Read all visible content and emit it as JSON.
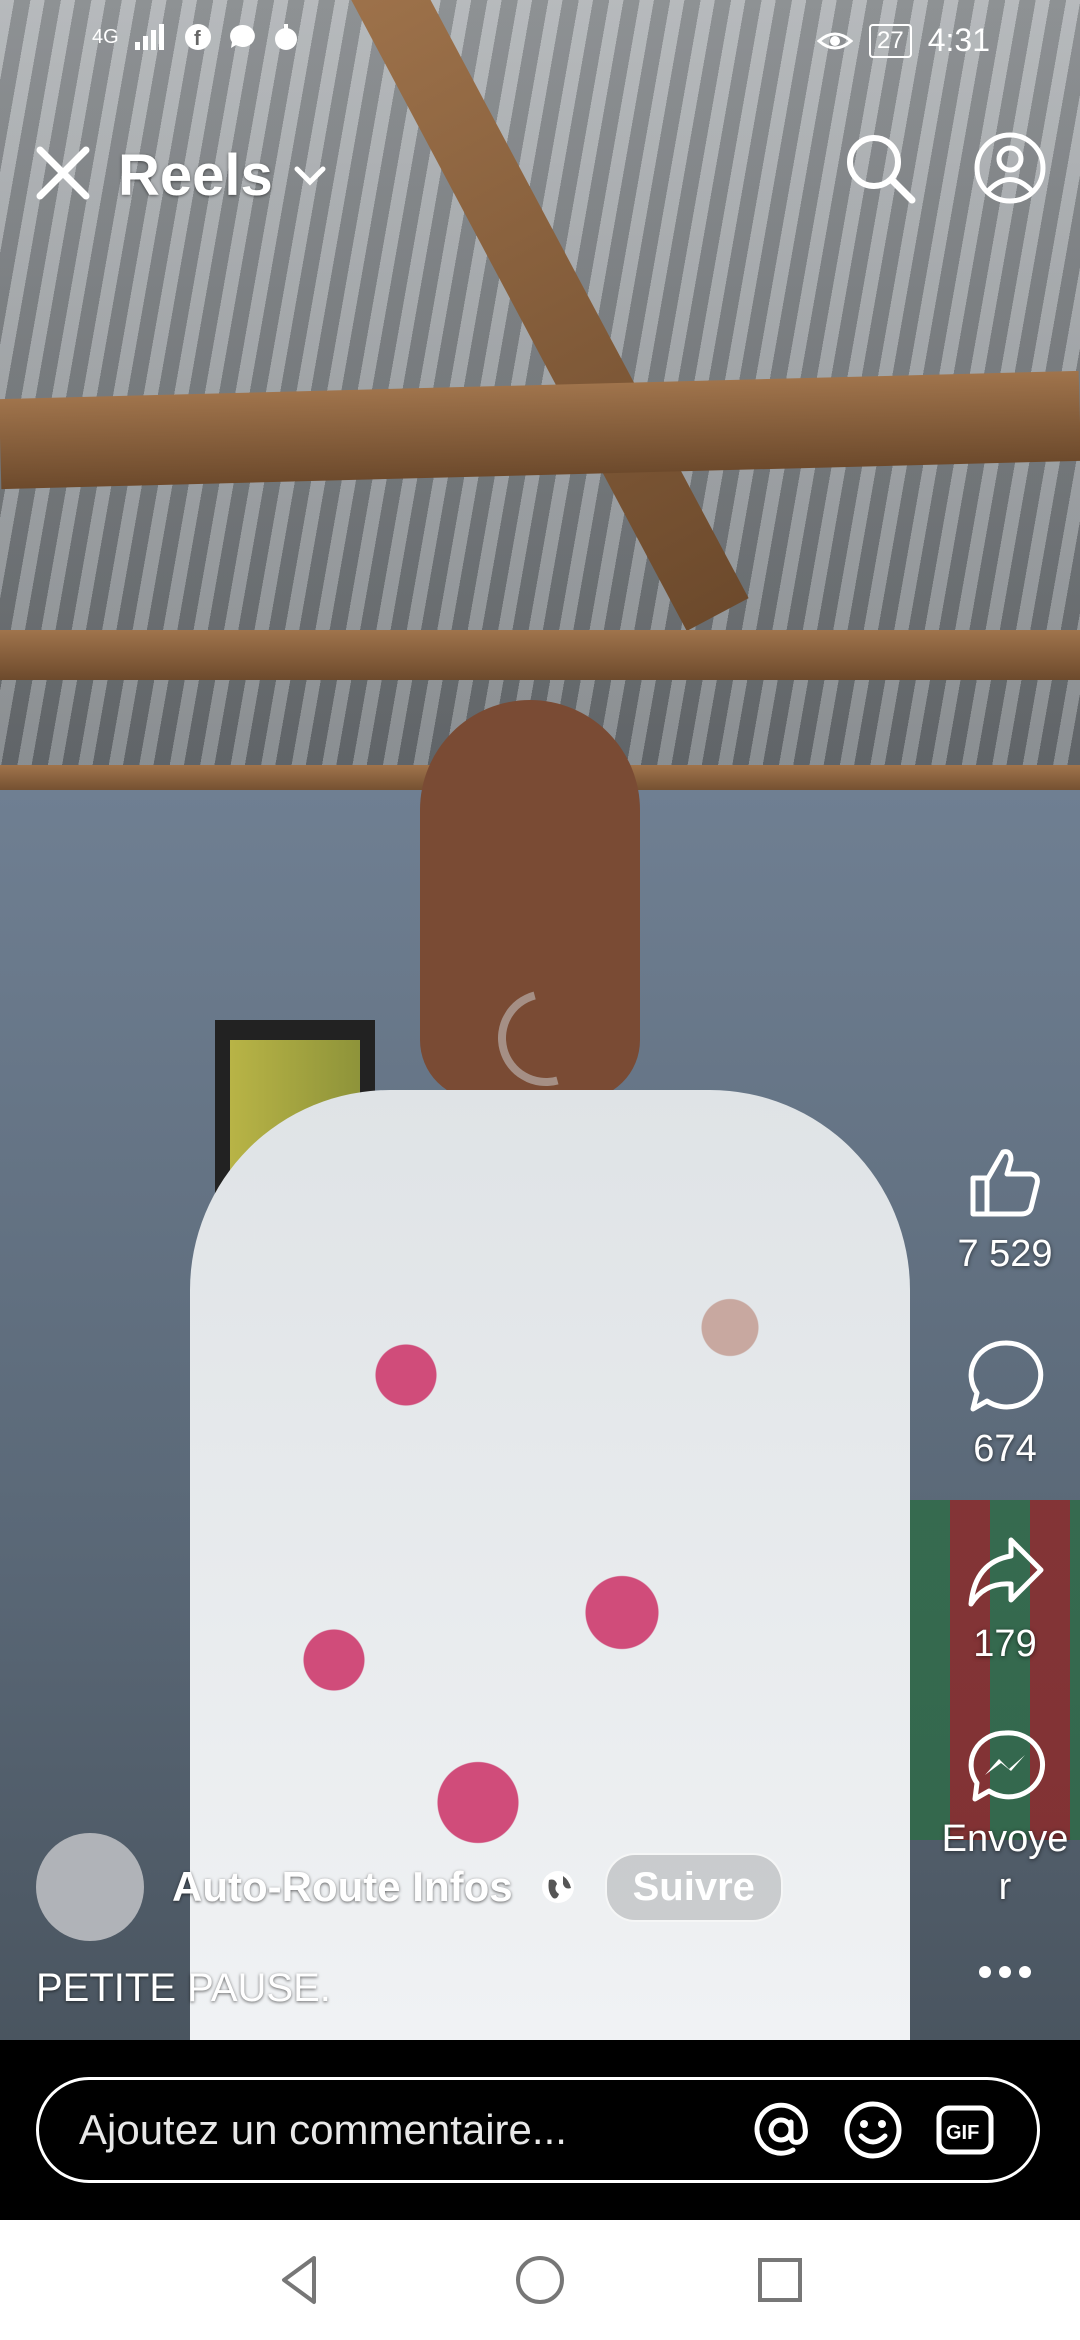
{
  "status_bar": {
    "network": "4G",
    "battery": "27",
    "time": "4:31"
  },
  "header": {
    "title": "Reels"
  },
  "actions": {
    "like_count": "7 529",
    "comment_count": "674",
    "share_count": "179",
    "send_label": "Envoye\nr"
  },
  "post": {
    "author": "Auto-Route Infos",
    "follow_label": "Suivre",
    "caption": "PETITE PAUSE."
  },
  "comment": {
    "placeholder": "Ajoutez un commentaire..."
  },
  "colors": {
    "background": "#000000",
    "text": "#ffffff",
    "navbar": "#ffffff"
  }
}
